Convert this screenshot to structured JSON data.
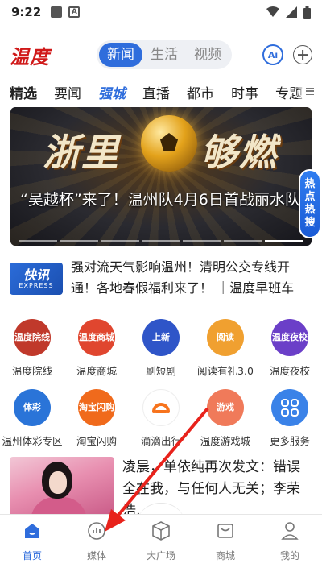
{
  "status_bar": {
    "time": "9:22"
  },
  "header": {
    "logo": "温度",
    "segments": [
      "新闻",
      "生活",
      "视频"
    ],
    "active_segment": 0
  },
  "channels": [
    "精选",
    "要闻",
    "强城",
    "直播",
    "都市",
    "时事",
    "专题"
  ],
  "banner": {
    "title_left": "浙里",
    "title_right": "够燃",
    "caption": "“吴越杯”来了！温州队4月6日首战丽水队"
  },
  "hot_badge": [
    "热",
    "点",
    "热",
    "搜"
  ],
  "flash": {
    "logo_main": "快讯",
    "logo_sub": "EXPRESS",
    "text": "强对流天气影响温州！清明公交专线开通！各地春假福利来了！ ｜温度早班车"
  },
  "services": [
    {
      "label": "温度院线",
      "icon_name": "cinema-icon",
      "icon_text": "温度院线",
      "color": "#c0392b"
    },
    {
      "label": "温度商城",
      "icon_name": "mall-icon",
      "icon_text": "温度商城",
      "color": "#e0462f"
    },
    {
      "label": "刷短剧",
      "icon_name": "short-drama-icon",
      "icon_text": "上新",
      "color": "#2f55c8"
    },
    {
      "label": "阅读有礼3.0",
      "icon_name": "reading-gift-icon",
      "icon_text": "阅读",
      "color": "#f0a030"
    },
    {
      "label": "温度夜校",
      "icon_name": "night-school-icon",
      "icon_text": "温度夜校",
      "color": "#6b3fc8"
    },
    {
      "label": "温州体彩专区",
      "icon_name": "lottery-icon",
      "icon_text": "体彩",
      "color": "#2a74d8"
    },
    {
      "label": "淘宝闪购",
      "icon_name": "taobao-flash-icon",
      "icon_text": "淘宝闪购",
      "color": "#f06a1c"
    },
    {
      "label": "滴滴出行",
      "icon_name": "didi-icon",
      "icon_text": "",
      "color": "#ffffff"
    },
    {
      "label": "温度游戏城",
      "icon_name": "game-city-icon",
      "icon_text": "游戏",
      "color": "#f07a5a"
    },
    {
      "label": "更多服务",
      "icon_name": "more-services-icon",
      "icon_text": "",
      "color": "#3a82e8"
    }
  ],
  "article": {
    "title": "凌晨，单依纯再次发文：错误全在我，与任何人无关；李荣浩…"
  },
  "bottom_nav": [
    {
      "label": "首页",
      "icon_name": "home-icon"
    },
    {
      "label": "媒体",
      "icon_name": "media-icon"
    },
    {
      "label": "大广场",
      "icon_name": "square-icon"
    },
    {
      "label": "商城",
      "icon_name": "shop-icon"
    },
    {
      "label": "我的",
      "icon_name": "profile-icon"
    }
  ],
  "active_nav": 0,
  "colors": {
    "accent": "#2f6ddc",
    "brand_red": "#d01919",
    "annotation_arrow": "#e8221b"
  }
}
